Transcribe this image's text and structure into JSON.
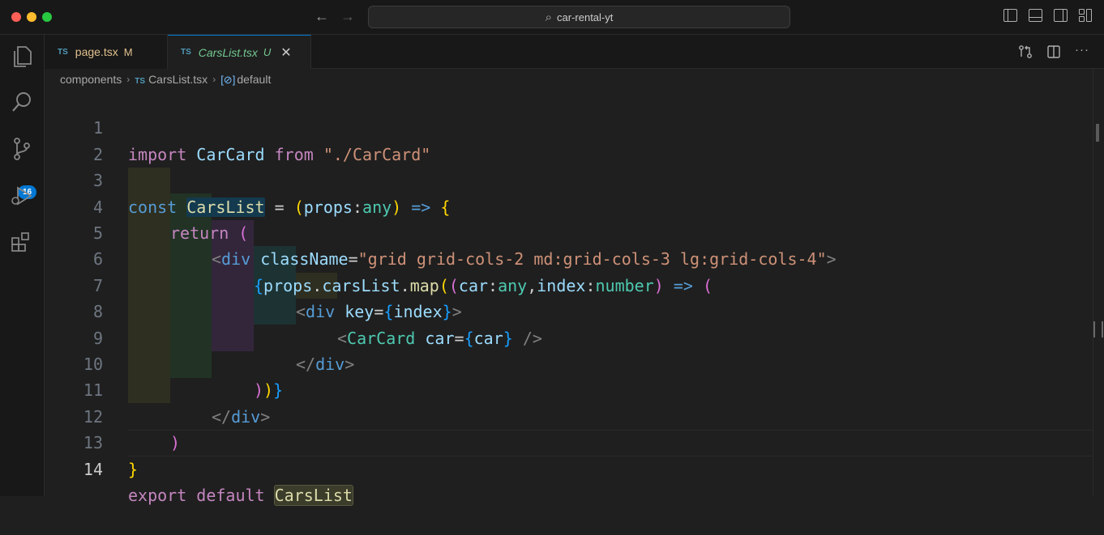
{
  "window": {
    "title": "car-rental-yt",
    "search_glyph": "⌕"
  },
  "activity_bar": {
    "source_control_badge": "16"
  },
  "tabs": [
    {
      "lang": "TS",
      "name": "page.tsx",
      "status": "M"
    },
    {
      "lang": "TS",
      "name": "CarsList.tsx",
      "status": "U",
      "close": "✕"
    }
  ],
  "breadcrumb": {
    "folder": "components",
    "lang": "TS",
    "file": "CarsList.tsx",
    "symbol_icon": "[⊘]",
    "symbol": "default",
    "sep": "›"
  },
  "editor": {
    "line_numbers": [
      "1",
      "2",
      "3",
      "4",
      "5",
      "6",
      "7",
      "8",
      "9",
      "10",
      "11",
      "12",
      "13",
      "14"
    ],
    "current_line": "14",
    "tokens": {
      "l1": [
        "import",
        " CarCard",
        " from",
        " \"./CarCard\""
      ],
      "l3": [
        "const",
        " ",
        "CarsList",
        " = ",
        "(",
        "props",
        ":",
        "any",
        ")",
        " => ",
        "{"
      ],
      "l4": [
        "return",
        " ("
      ],
      "l5": [
        "<",
        "div",
        " ",
        "className",
        "=",
        "\"grid grid-cols-2 md:grid-cols-3 lg:grid-cols-4\"",
        ">"
      ],
      "l6": [
        "{",
        "props",
        ".",
        "carsList",
        ".",
        "map",
        "(",
        "(",
        "car",
        ":",
        "any",
        ",",
        "index",
        ":",
        "number",
        ")",
        " => ",
        "("
      ],
      "l7": [
        "<",
        "div",
        " ",
        "key",
        "=",
        "{",
        "index",
        "}",
        ">"
      ],
      "l8": [
        "<",
        "CarCard",
        " ",
        "car",
        "=",
        "{",
        "car",
        "}",
        " />"
      ],
      "l9": [
        "</",
        "div",
        ">"
      ],
      "l10": [
        ")",
        ")",
        "}"
      ],
      "l11": [
        "</",
        "div",
        ">"
      ],
      "l12": [
        ")"
      ],
      "l13": [
        "}"
      ],
      "l14": [
        "export",
        " default",
        " ",
        "CarsList"
      ]
    }
  },
  "colors": {
    "accent": "#0078d4",
    "keyword": "#569cd6",
    "control": "#c586c0",
    "string": "#ce9178",
    "type": "#4ec9b0",
    "variable": "#9cdcfe",
    "function": "#dcdcaa"
  }
}
